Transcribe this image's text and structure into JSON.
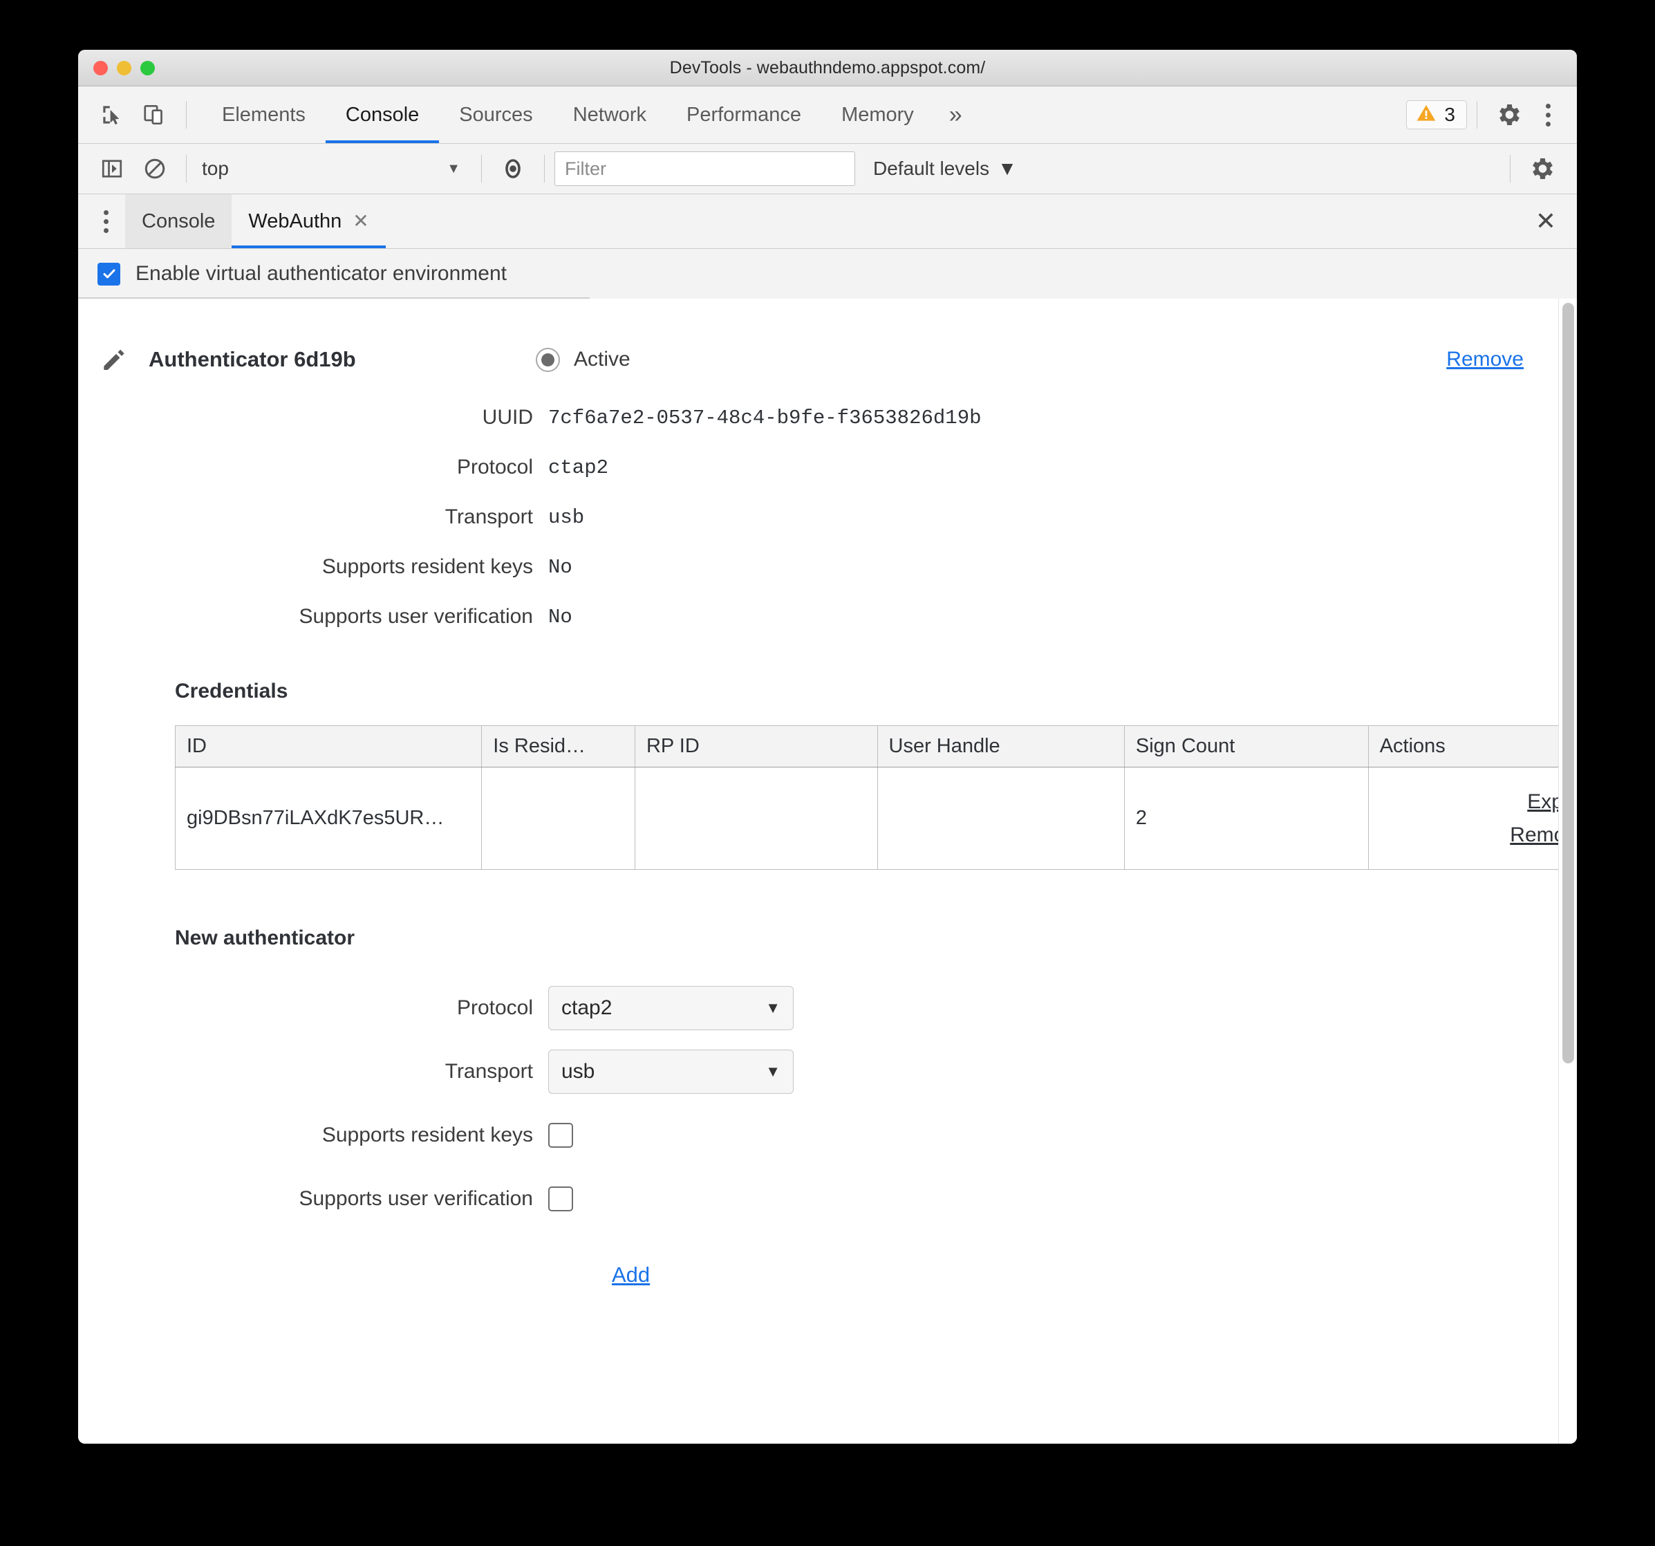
{
  "window": {
    "title": "DevTools - webauthndemo.appspot.com/"
  },
  "main_toolbar": {
    "inspect_icon": "inspect-element-icon",
    "device_icon": "device-toolbar-icon",
    "panels": [
      {
        "label": "Elements",
        "active": false
      },
      {
        "label": "Console",
        "active": true
      },
      {
        "label": "Sources",
        "active": false
      },
      {
        "label": "Network",
        "active": false
      },
      {
        "label": "Performance",
        "active": false
      },
      {
        "label": "Memory",
        "active": false
      }
    ],
    "more_panels": "»",
    "warning_count": "3",
    "settings_icon": "gear-icon",
    "menu_icon": "kebab-menu-icon"
  },
  "console_toolbar": {
    "sidebar_toggle_icon": "console-sidebar-icon",
    "clear_icon": "clear-console-icon",
    "context": "top",
    "context_caret": "▼",
    "live_expression_icon": "eye-icon",
    "filter_placeholder": "Filter",
    "filter_value": "",
    "levels": "Default levels",
    "levels_caret": "▼",
    "settings_icon": "gear-icon"
  },
  "drawer": {
    "menu_icon": "kebab-menu-icon",
    "tabs": [
      {
        "label": "Console",
        "active": false,
        "closable": false
      },
      {
        "label": "WebAuthn",
        "active": true,
        "closable": true
      }
    ],
    "tab_close_glyph": "✕",
    "close_glyph": "✕"
  },
  "enable_row": {
    "label": "Enable virtual authenticator environment",
    "checked": true
  },
  "authenticator": {
    "edit_icon": "pencil-icon",
    "title": "Authenticator 6d19b",
    "active_label": "Active",
    "active_selected": true,
    "remove_label": "Remove",
    "details": [
      {
        "label": "UUID",
        "value": "7cf6a7e2-0537-48c4-b9fe-f3653826d19b"
      },
      {
        "label": "Protocol",
        "value": "ctap2"
      },
      {
        "label": "Transport",
        "value": "usb"
      },
      {
        "label": "Supports resident keys",
        "value": "No"
      },
      {
        "label": "Supports user verification",
        "value": "No"
      }
    ]
  },
  "credentials": {
    "heading": "Credentials",
    "columns": [
      "ID",
      "Is Resid…",
      "RP ID",
      "User Handle",
      "Sign Count",
      "Actions"
    ],
    "rows": [
      {
        "id": "gi9DBsn77iLAXdK7es5UR…",
        "is_resident": "",
        "rp_id": "",
        "user_handle": "",
        "sign_count": "2",
        "actions": [
          "Export",
          "Remove"
        ]
      }
    ]
  },
  "new_authenticator": {
    "heading": "New authenticator",
    "protocol_label": "Protocol",
    "protocol_value": "ctap2",
    "transport_label": "Transport",
    "transport_value": "usb",
    "resident_keys_label": "Supports resident keys",
    "resident_keys_checked": false,
    "user_verification_label": "Supports user verification",
    "user_verification_checked": false,
    "add_label": "Add",
    "caret": "▼"
  },
  "colors": {
    "accent_blue": "#1a73e8",
    "warning_yellow": "#f5a623",
    "toolbar_bg": "#f3f3f3",
    "text_dark": "#2f3237"
  }
}
